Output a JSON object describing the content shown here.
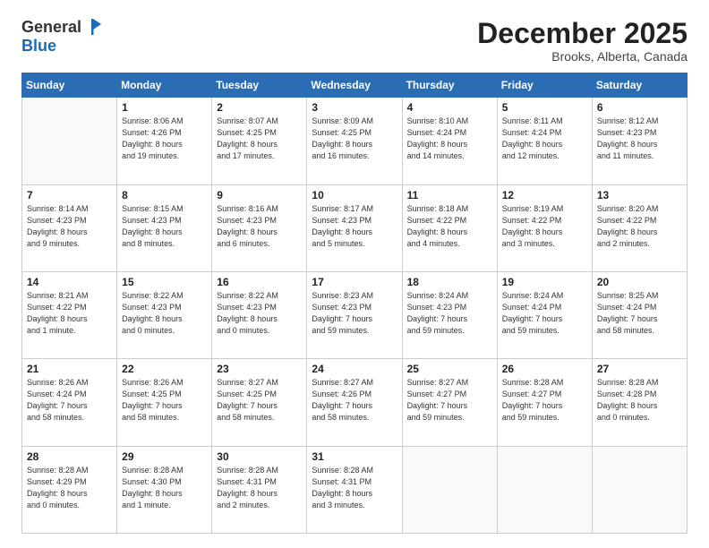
{
  "logo": {
    "general": "General",
    "blue": "Blue"
  },
  "title": "December 2025",
  "location": "Brooks, Alberta, Canada",
  "days_header": [
    "Sunday",
    "Monday",
    "Tuesday",
    "Wednesday",
    "Thursday",
    "Friday",
    "Saturday"
  ],
  "weeks": [
    [
      {
        "day": "",
        "info": ""
      },
      {
        "day": "1",
        "info": "Sunrise: 8:06 AM\nSunset: 4:26 PM\nDaylight: 8 hours\nand 19 minutes."
      },
      {
        "day": "2",
        "info": "Sunrise: 8:07 AM\nSunset: 4:25 PM\nDaylight: 8 hours\nand 17 minutes."
      },
      {
        "day": "3",
        "info": "Sunrise: 8:09 AM\nSunset: 4:25 PM\nDaylight: 8 hours\nand 16 minutes."
      },
      {
        "day": "4",
        "info": "Sunrise: 8:10 AM\nSunset: 4:24 PM\nDaylight: 8 hours\nand 14 minutes."
      },
      {
        "day": "5",
        "info": "Sunrise: 8:11 AM\nSunset: 4:24 PM\nDaylight: 8 hours\nand 12 minutes."
      },
      {
        "day": "6",
        "info": "Sunrise: 8:12 AM\nSunset: 4:23 PM\nDaylight: 8 hours\nand 11 minutes."
      }
    ],
    [
      {
        "day": "7",
        "info": "Sunrise: 8:14 AM\nSunset: 4:23 PM\nDaylight: 8 hours\nand 9 minutes."
      },
      {
        "day": "8",
        "info": "Sunrise: 8:15 AM\nSunset: 4:23 PM\nDaylight: 8 hours\nand 8 minutes."
      },
      {
        "day": "9",
        "info": "Sunrise: 8:16 AM\nSunset: 4:23 PM\nDaylight: 8 hours\nand 6 minutes."
      },
      {
        "day": "10",
        "info": "Sunrise: 8:17 AM\nSunset: 4:23 PM\nDaylight: 8 hours\nand 5 minutes."
      },
      {
        "day": "11",
        "info": "Sunrise: 8:18 AM\nSunset: 4:22 PM\nDaylight: 8 hours\nand 4 minutes."
      },
      {
        "day": "12",
        "info": "Sunrise: 8:19 AM\nSunset: 4:22 PM\nDaylight: 8 hours\nand 3 minutes."
      },
      {
        "day": "13",
        "info": "Sunrise: 8:20 AM\nSunset: 4:22 PM\nDaylight: 8 hours\nand 2 minutes."
      }
    ],
    [
      {
        "day": "14",
        "info": "Sunrise: 8:21 AM\nSunset: 4:22 PM\nDaylight: 8 hours\nand 1 minute."
      },
      {
        "day": "15",
        "info": "Sunrise: 8:22 AM\nSunset: 4:23 PM\nDaylight: 8 hours\nand 0 minutes."
      },
      {
        "day": "16",
        "info": "Sunrise: 8:22 AM\nSunset: 4:23 PM\nDaylight: 8 hours\nand 0 minutes."
      },
      {
        "day": "17",
        "info": "Sunrise: 8:23 AM\nSunset: 4:23 PM\nDaylight: 7 hours\nand 59 minutes."
      },
      {
        "day": "18",
        "info": "Sunrise: 8:24 AM\nSunset: 4:23 PM\nDaylight: 7 hours\nand 59 minutes."
      },
      {
        "day": "19",
        "info": "Sunrise: 8:24 AM\nSunset: 4:24 PM\nDaylight: 7 hours\nand 59 minutes."
      },
      {
        "day": "20",
        "info": "Sunrise: 8:25 AM\nSunset: 4:24 PM\nDaylight: 7 hours\nand 58 minutes."
      }
    ],
    [
      {
        "day": "21",
        "info": "Sunrise: 8:26 AM\nSunset: 4:24 PM\nDaylight: 7 hours\nand 58 minutes."
      },
      {
        "day": "22",
        "info": "Sunrise: 8:26 AM\nSunset: 4:25 PM\nDaylight: 7 hours\nand 58 minutes."
      },
      {
        "day": "23",
        "info": "Sunrise: 8:27 AM\nSunset: 4:25 PM\nDaylight: 7 hours\nand 58 minutes."
      },
      {
        "day": "24",
        "info": "Sunrise: 8:27 AM\nSunset: 4:26 PM\nDaylight: 7 hours\nand 58 minutes."
      },
      {
        "day": "25",
        "info": "Sunrise: 8:27 AM\nSunset: 4:27 PM\nDaylight: 7 hours\nand 59 minutes."
      },
      {
        "day": "26",
        "info": "Sunrise: 8:28 AM\nSunset: 4:27 PM\nDaylight: 7 hours\nand 59 minutes."
      },
      {
        "day": "27",
        "info": "Sunrise: 8:28 AM\nSunset: 4:28 PM\nDaylight: 8 hours\nand 0 minutes."
      }
    ],
    [
      {
        "day": "28",
        "info": "Sunrise: 8:28 AM\nSunset: 4:29 PM\nDaylight: 8 hours\nand 0 minutes."
      },
      {
        "day": "29",
        "info": "Sunrise: 8:28 AM\nSunset: 4:30 PM\nDaylight: 8 hours\nand 1 minute."
      },
      {
        "day": "30",
        "info": "Sunrise: 8:28 AM\nSunset: 4:31 PM\nDaylight: 8 hours\nand 2 minutes."
      },
      {
        "day": "31",
        "info": "Sunrise: 8:28 AM\nSunset: 4:31 PM\nDaylight: 8 hours\nand 3 minutes."
      },
      {
        "day": "",
        "info": ""
      },
      {
        "day": "",
        "info": ""
      },
      {
        "day": "",
        "info": ""
      }
    ]
  ]
}
